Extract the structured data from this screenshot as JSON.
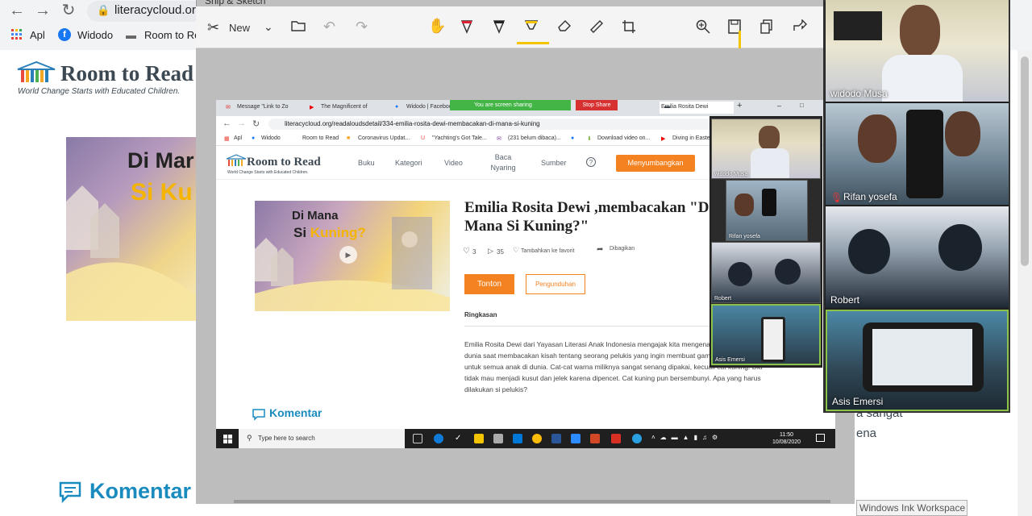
{
  "bg_browser": {
    "url": "literacycloud.org",
    "bookmarks": [
      "Apl",
      "Widodo",
      "Room to Rea"
    ]
  },
  "bg_page": {
    "logo_text": "Room to Read",
    "logo_tagline": "World Change Starts with Educated Children.",
    "book_title_a": "Di Mar",
    "book_title_b": "Si Ku",
    "komentar": "Komentar",
    "side_text_1": "a sangat",
    "side_text_2": "ena"
  },
  "snip": {
    "title": "Snip & Sketch",
    "new_label": "New"
  },
  "inner": {
    "tabs": [
      "Message \"Link to Zo",
      "The Magnificent of",
      "Widodo | Faceboo",
      "Emilia Rosita Dewi"
    ],
    "share_label": "You are screen sharing",
    "stop_share": "Stop Share",
    "url": "literacycloud.org/readaloudsdetail/334-emilia-rosita-dewi-membacakan-di-mana-si-kuning",
    "bookmarks": [
      "Apl",
      "Widodo",
      "Room to Read",
      "Coronavirus Updat...",
      "\"Yachting's Got Tale...",
      "(231 belum dibaca)...",
      "Download video on...",
      "Diving in Easte"
    ],
    "logo_text": "Room to Read",
    "logo_tagline": "World Change Starts with Educated Children.",
    "nav": [
      "Buku",
      "Kategori",
      "Video",
      "Baca Nyaring",
      "Sumber"
    ],
    "help": "?",
    "donate": "Menyumbangkan",
    "book_line1": "Di Mana",
    "book_line2_a": "Si ",
    "book_line2_b": "Kuning?",
    "title": "Emilia Rosita Dewi ,membacakan \"Di Mana Si Kuning?\"",
    "likes": "3",
    "plays": "35",
    "favorite": "Tambahkan ke favorit",
    "shared": "Dibagikan",
    "watch": "Tonton",
    "download": "Pengunduhan",
    "summary_heading": "Ringkasan",
    "summary": "Emilia Rosita Dewi dari Yayasan Literasi Anak Indonesia mengajak kita mengenal warna-warna dunia saat membacakan kisah tentang seorang pelukis yang ingin membuat gambar terindah untuk semua anak di dunia. Cat-cat warna miliknya sangat senang dipakai, kecuali cat kuning. Dia tidak mau menjadi kusut dan jelek karena dipencet. Cat kuning pun bersembunyi. Apa yang harus dilakukan si pelukis?",
    "komentar": "Komentar",
    "search_placeholder": "Type here to search",
    "clock_time": "11:50",
    "clock_date": "10/08/2020",
    "participants": [
      "widodo Musa",
      "Rifan yosefa",
      "Robert",
      "Asis Emersi"
    ]
  },
  "zoom": {
    "participants": [
      "widodo Musa",
      "Rifan yosefa",
      "Robert",
      "Asis Emersi"
    ]
  },
  "tooltip": "Windows Ink Workspace"
}
